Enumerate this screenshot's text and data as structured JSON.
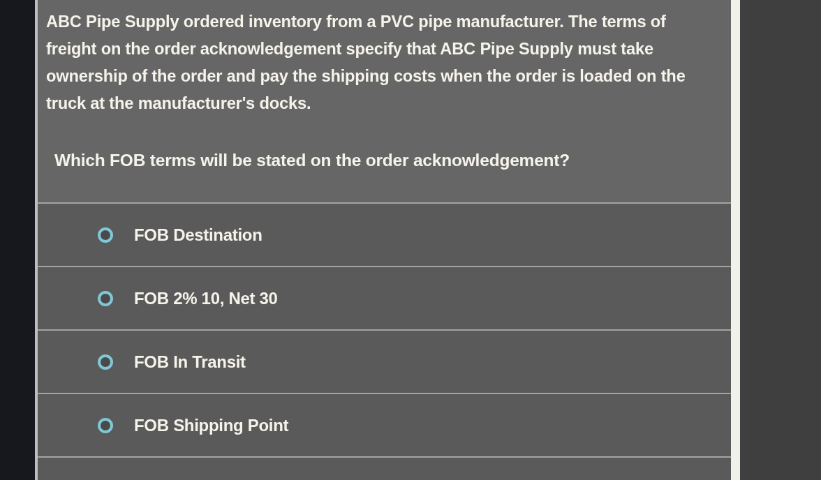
{
  "question": {
    "scenario": "ABC Pipe Supply ordered inventory from a PVC pipe manufacturer. The terms of freight on the order acknowledgement specify that ABC Pipe Supply must take ownership of the order and pay the shipping costs when the order is loaded on the truck at the manufacturer's docks.",
    "prompt": "Which FOB terms will be stated on the order acknowledgement?"
  },
  "options": [
    {
      "label": "FOB Destination",
      "selected": false
    },
    {
      "label": "FOB 2% 10, Net 30",
      "selected": false
    },
    {
      "label": "FOB In Transit",
      "selected": false
    },
    {
      "label": "FOB Shipping Point",
      "selected": false
    }
  ]
}
